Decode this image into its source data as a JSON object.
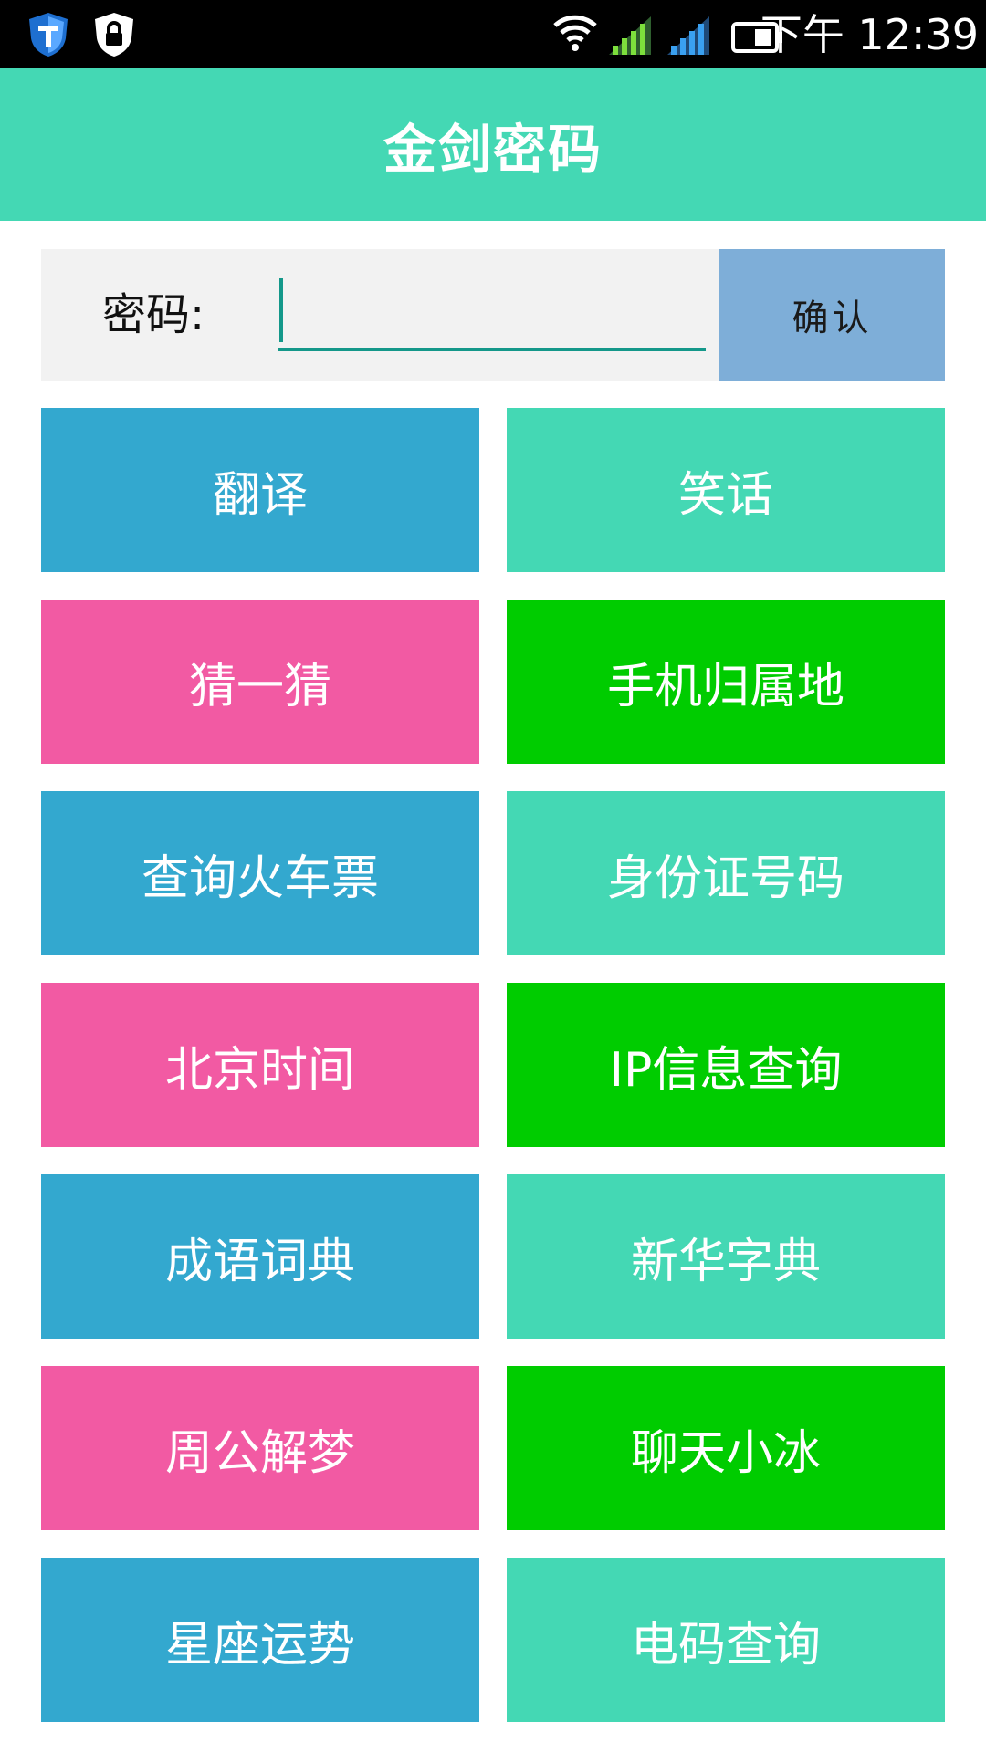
{
  "status_bar": {
    "time": "下午 12:39",
    "icons": [
      "shield-icon",
      "lock-shield-icon",
      "wifi-icon",
      "signal-green-icon",
      "signal-blue-icon",
      "battery-icon"
    ]
  },
  "app_bar": {
    "title": "金剑密码"
  },
  "password": {
    "label": "密码:",
    "value": "",
    "confirm_label": "确认"
  },
  "colors": {
    "teal": "#44d8b4",
    "blue": "#33a8cf",
    "pink": "#f25aa3",
    "green": "#00cc00",
    "confirm": "#7eaed8"
  },
  "menu": {
    "items": [
      {
        "label": "翻译",
        "color": "#33a8cf"
      },
      {
        "label": "笑话",
        "color": "#44d8b4"
      },
      {
        "label": "猜一猜",
        "color": "#f25aa3"
      },
      {
        "label": "手机归属地",
        "color": "#00cc00"
      },
      {
        "label": "查询火车票",
        "color": "#33a8cf"
      },
      {
        "label": "身份证号码",
        "color": "#44d8b4"
      },
      {
        "label": "北京时间",
        "color": "#f25aa3"
      },
      {
        "label": "IP信息查询",
        "color": "#00cc00"
      },
      {
        "label": "成语词典",
        "color": "#33a8cf"
      },
      {
        "label": "新华字典",
        "color": "#44d8b4"
      },
      {
        "label": "周公解梦",
        "color": "#f25aa3"
      },
      {
        "label": "聊天小冰",
        "color": "#00cc00"
      },
      {
        "label": "星座运势",
        "color": "#33a8cf"
      },
      {
        "label": "电码查询",
        "color": "#44d8b4"
      }
    ]
  }
}
